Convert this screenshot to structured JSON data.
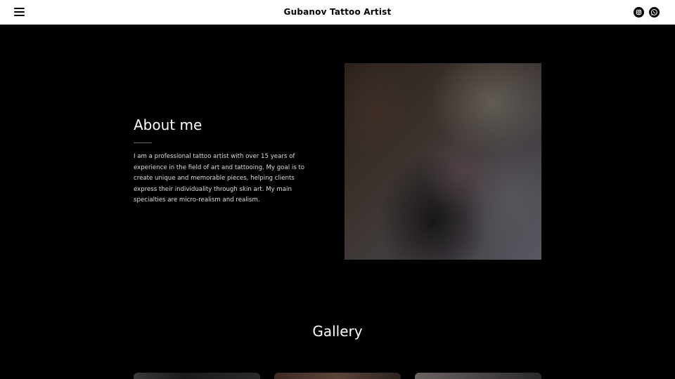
{
  "header": {
    "title": "Gubanov Tattoo Artist",
    "menu_icon": "hamburger-icon",
    "social": [
      {
        "name": "instagram-icon"
      },
      {
        "name": "whatsapp-icon"
      }
    ]
  },
  "about": {
    "title": "About me",
    "text": "I am a professional tattoo artist with over 15 years of experience in the field of art and tattooing. My goal is to create unique and memorable pieces, helping clients express their individuality through skin art. My main specialties are micro-realism and realism."
  },
  "gallery": {
    "title": "Gallery"
  },
  "colors": {
    "background": "#000000",
    "header_background": "#ffffff",
    "text": "#ffffff"
  }
}
